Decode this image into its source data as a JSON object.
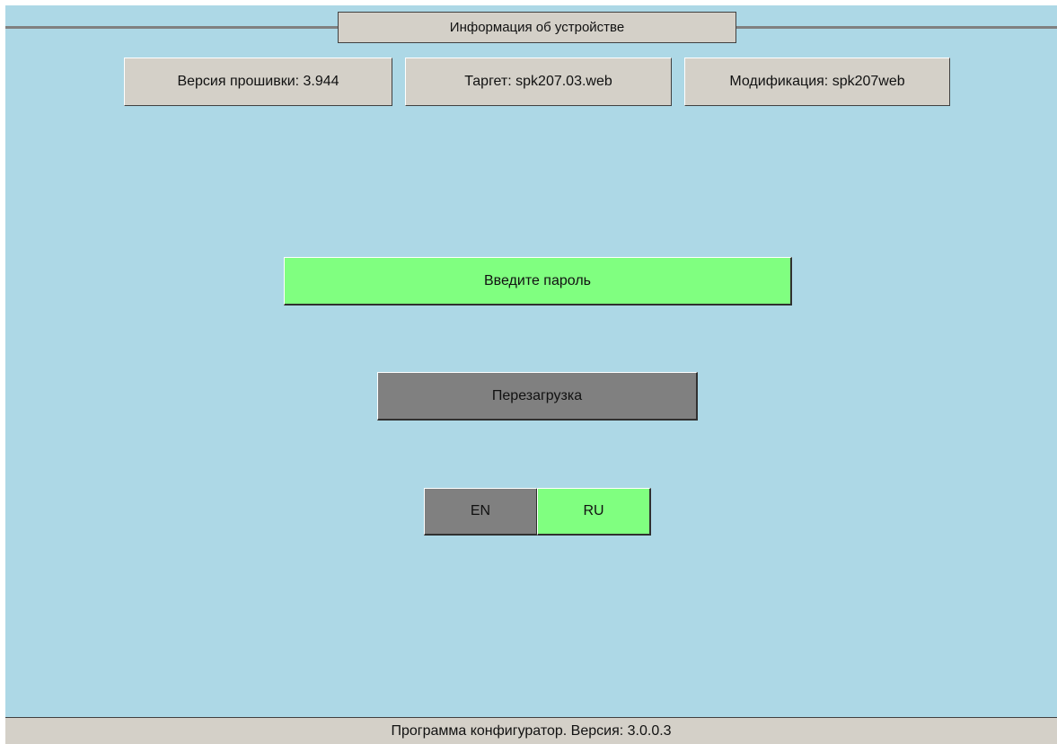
{
  "header": {
    "title": "Информация об устройстве"
  },
  "device_info": {
    "firmware": "Версия прошивки: 3.944",
    "target": "Таргет: spk207.03.web",
    "modification": "Модификация: spk207web"
  },
  "actions": {
    "password_label": "Введите пароль",
    "reboot_label": "Перезагрузка"
  },
  "language": {
    "options": [
      "EN",
      "RU"
    ],
    "selected": "RU"
  },
  "footer": {
    "text": "Программа конфигуратор. Версия: 3.0.0.3"
  },
  "colors": {
    "background": "#add8e6",
    "panel": "#d4d0c8",
    "active": "#80ff80",
    "inactive": "#808080"
  }
}
